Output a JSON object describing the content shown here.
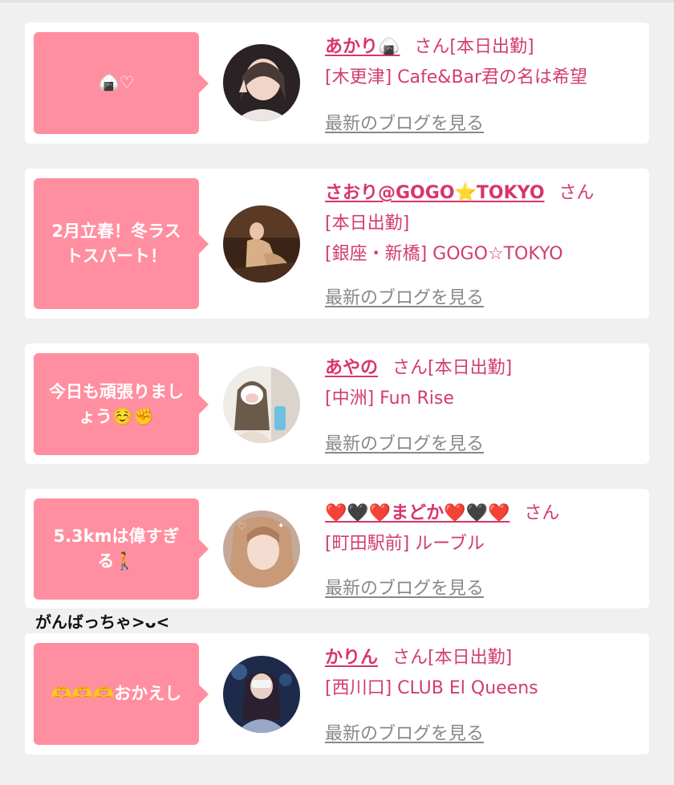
{
  "entries": [
    {
      "bubble": "🍙♡",
      "name": "あかり🍙",
      "san": "さん",
      "status": "[本日出勤]",
      "shop": "[木更津] Cafe&Bar君の名は希望",
      "blog": "最新のブログを見る",
      "avatar_icon": "avatar-photo"
    },
    {
      "bubble": "2月立春！冬ラストスパート！",
      "name": "さおり@GOGO⭐TOKYO",
      "san": "さん",
      "status": "[本日出勤]",
      "shop": "[銀座・新橋] GOGO☆TOKYO",
      "blog": "最新のブログを見る",
      "avatar_icon": "avatar-photo"
    },
    {
      "bubble": "今日も頑張りましょう☺️✊",
      "name": "あやの",
      "san": "さん",
      "status": "[本日出勤]",
      "shop": "[中洲] Fun Rise",
      "blog": "最新のブログを見る",
      "avatar_icon": "avatar-photo"
    },
    {
      "bubble": "5.3kmは偉すぎる🚶",
      "name": "❤️🖤❤️まどか❤️🖤❤️",
      "san": "さん",
      "status": "",
      "shop": "[町田駅前] ルーブル",
      "blog": "最新のブログを見る",
      "avatar_icon": "avatar-photo"
    },
    {
      "bubble": "🫶🫶🫶おかえし",
      "name": "かりん",
      "san": "さん",
      "status": "[本日出勤]",
      "shop": "[西川口] CLUB El Queens",
      "blog": "最新のブログを見る",
      "avatar_icon": "avatar-photo"
    }
  ],
  "overflow_note": "がんばっちゃ>ᴗ<",
  "colors": {
    "accent": "#d8356b",
    "bubble": "#ff8fa0",
    "link_gray": "#888888"
  }
}
